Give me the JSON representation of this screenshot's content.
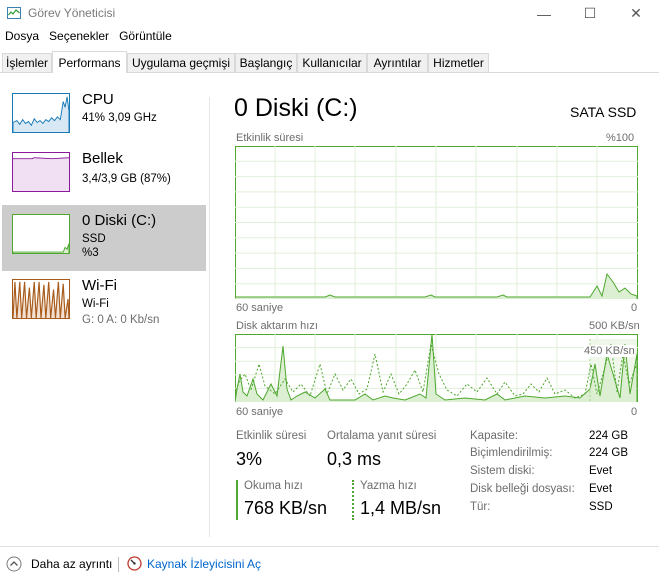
{
  "window": {
    "title": "Görev Yöneticisi",
    "minimize": "—",
    "maximize": "☐",
    "close": "✕"
  },
  "menu": [
    "Dosya",
    "Seçenekler",
    "Görüntüle"
  ],
  "tabs": [
    "İşlemler",
    "Performans",
    "Uygulama geçmişi",
    "Başlangıç",
    "Kullanıcılar",
    "Ayrıntılar",
    "Hizmetler"
  ],
  "active_tab": "Performans",
  "sidebar": {
    "cpu": {
      "title": "CPU",
      "sub": "41%  3,09 GHz",
      "color": "#1a7ab8"
    },
    "memory": {
      "title": "Bellek",
      "sub": "3,4/3,9 GB (87%)",
      "color": "#8b1a9a"
    },
    "disk": {
      "title": "0 Diski (C:)",
      "sub1": "SSD",
      "sub2": "%3",
      "color": "#4ea72e"
    },
    "wifi": {
      "title": "Wi-Fi",
      "sub1": "Wi-Fi",
      "sub2": "G: 0  A: 0 Kb/sn",
      "color": "#a75a1a"
    }
  },
  "main": {
    "title": "0 Diski (C:)",
    "model": "SATA SSD",
    "chart1": {
      "label": "Etkinlik süresi",
      "max": "%100",
      "xlabel": "60 saniye",
      "xmin": "0"
    },
    "chart2": {
      "label": "Disk aktarım hızı",
      "max": "500 KB/sn",
      "marker": "450 KB/sn",
      "xlabel": "60 saniye",
      "xmin": "0"
    },
    "stats": {
      "active_label": "Etkinlik süresi",
      "active_val": "3%",
      "resp_label": "Ortalama yanıt süresi",
      "resp_val": "0,3 ms",
      "read_label": "Okuma hızı",
      "read_val": "768 KB/sn",
      "write_label": "Yazma hızı",
      "write_val": "1,4 MB/sn"
    },
    "props": [
      {
        "label": "Kapasite:",
        "value": "224 GB"
      },
      {
        "label": "Biçimlendirilmiş:",
        "value": "224 GB"
      },
      {
        "label": "Sistem diski:",
        "value": "Evet"
      },
      {
        "label": "Disk belleği dosyası:",
        "value": "Evet"
      },
      {
        "label": "Tür:",
        "value": "SSD"
      }
    ]
  },
  "footer": {
    "less_details": "Daha az ayrıntı",
    "resource_monitor": "Kaynak İzleyicisini Aç"
  },
  "colors": {
    "disk_green": "#4ea72e",
    "link_blue": "#0066cc"
  }
}
